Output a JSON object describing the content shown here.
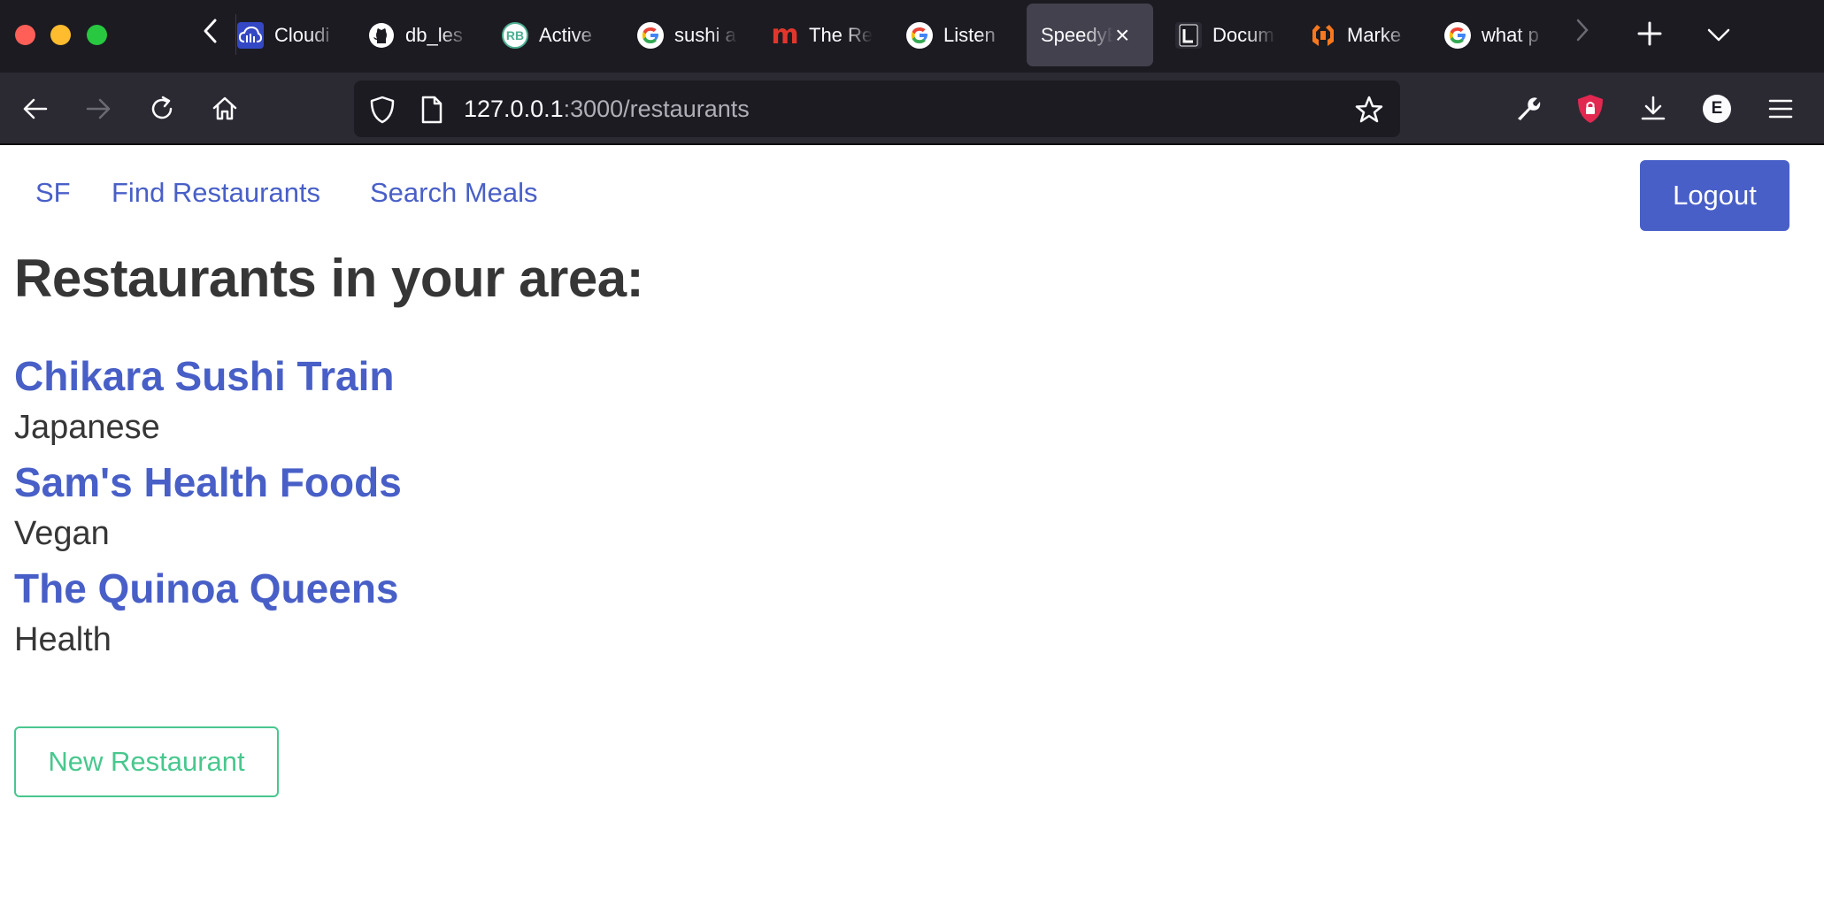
{
  "browser": {
    "tabs": [
      {
        "title": "Cloudi",
        "icon": "cloudinary-icon",
        "icon_color": "#3448c5"
      },
      {
        "title": "db_les",
        "icon": "github-icon",
        "icon_color": "#ffffff"
      },
      {
        "title": "Active",
        "icon": "rb-icon",
        "icon_text": "RB",
        "icon_color": "#4caf91"
      },
      {
        "title": "sushi a",
        "icon": "google-icon",
        "icon_color": "#4285f4"
      },
      {
        "title": "The Re",
        "icon": "m-icon",
        "icon_text": "m",
        "icon_color": "#e2362d"
      },
      {
        "title": "Listen",
        "icon": "google-icon",
        "icon_color": "#4285f4"
      },
      {
        "title": "Docum",
        "icon": "document-icon",
        "icon_color": "#ffffff"
      },
      {
        "title": "Marke",
        "icon": "marketplace-icon",
        "icon_color": "#f7781f"
      },
      {
        "title": "what p",
        "icon": "google-icon",
        "icon_color": "#4285f4"
      }
    ],
    "active_tab": {
      "title": "SpeedyEats"
    },
    "url": {
      "host": "127.0.0.1",
      "rest": ":3000/restaurants"
    },
    "extension_initial": "E"
  },
  "nav": {
    "city": "SF",
    "find": "Find Restaurants",
    "search": "Search Meals",
    "logout": "Logout"
  },
  "main": {
    "heading": "Restaurants in your area:",
    "restaurants": [
      {
        "name": "Chikara Sushi Train",
        "category": "Japanese"
      },
      {
        "name": "Sam's Health Foods",
        "category": "Vegan"
      },
      {
        "name": "The Quinoa Queens",
        "category": "Health"
      }
    ],
    "new_button": "New Restaurant"
  },
  "colors": {
    "link": "#485fc7",
    "primary_button": "#485fc7",
    "success_outline": "#48c78e",
    "text": "#363636"
  }
}
